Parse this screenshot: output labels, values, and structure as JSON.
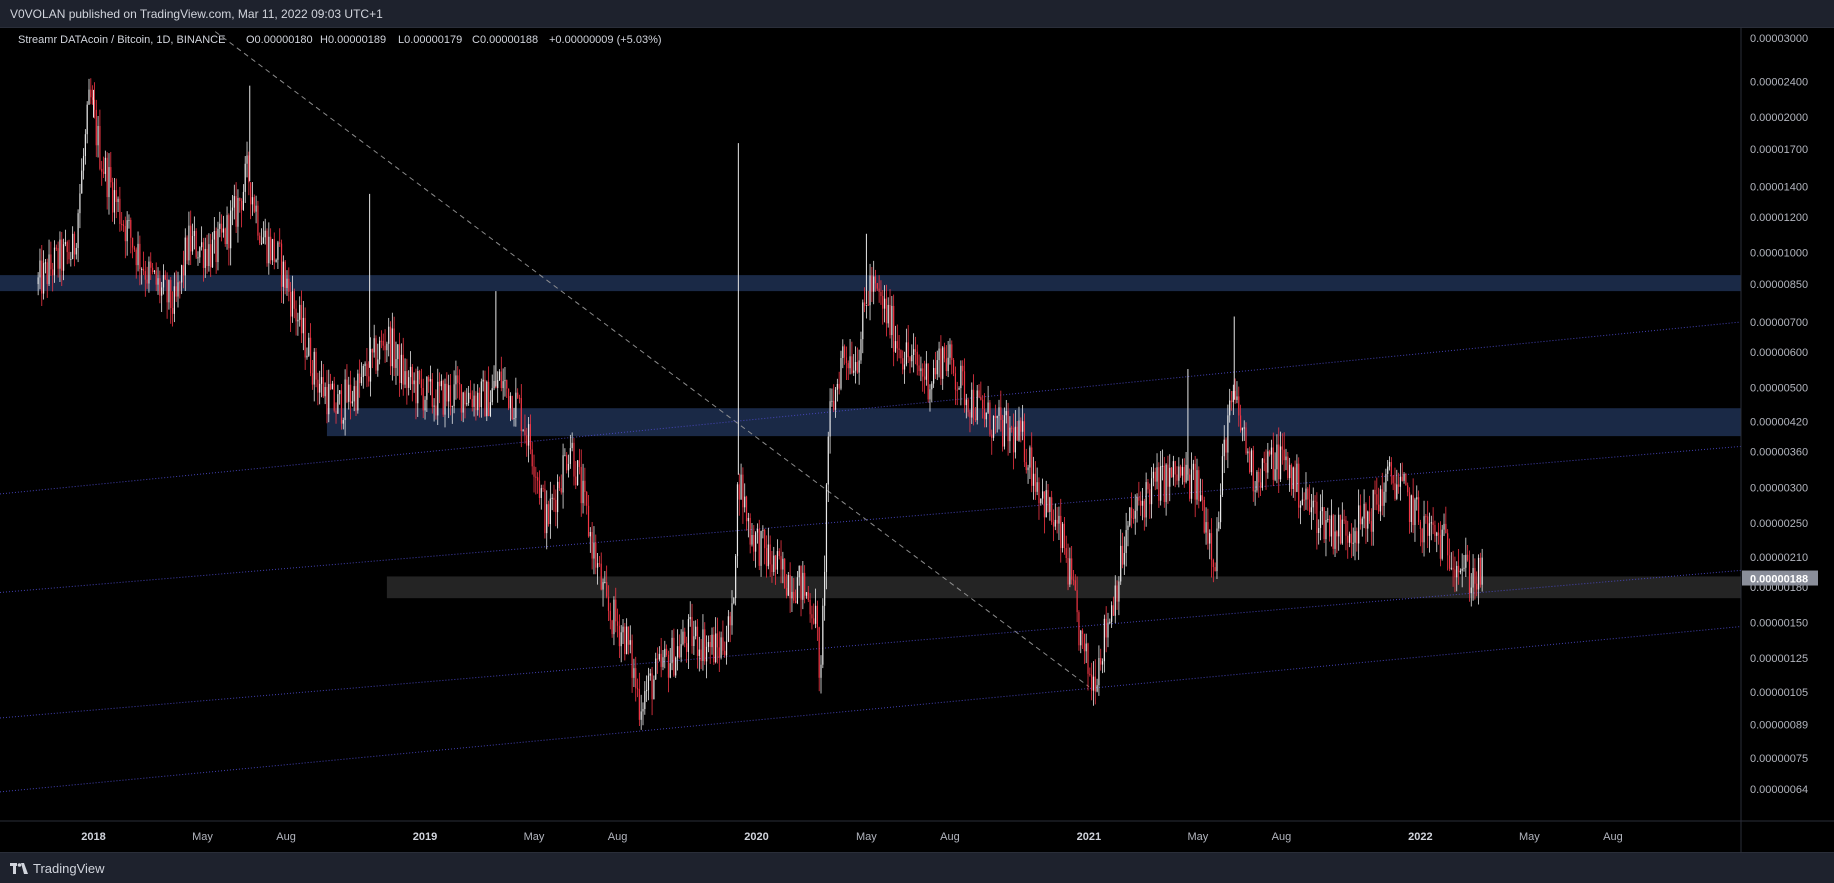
{
  "header": {
    "publish_text": "V0VOLAN published on TradingView.com, Mar 11, 2022 09:03 UTC+1"
  },
  "footer": {
    "brand_label": "TradingView"
  },
  "colors": {
    "background": "#000000",
    "frame": "#131722",
    "candle_up": "#e8e8e8",
    "candle_down": "#f23645",
    "zone_blue": "#1b2b4a",
    "zone_gray": "#2a2a2a",
    "channel_line": "#4b49c8",
    "trend_dash": "#9a9a9a",
    "price_label_bg": "#8a8e9a"
  },
  "chart_data": {
    "type": "candlestick",
    "legend": {
      "symbol": "Streamr DATAcoin / Bitcoin, 1D, BINANCE",
      "open": "O0.00000180",
      "high": "H0.00000189",
      "low": "L0.00000179",
      "close": "C0.00000188",
      "change": "+0.00000009 (+5.03%)"
    },
    "last_price_label": "0.00000188",
    "y_scale": "log",
    "ylim": [
      5.8e-07,
      3e-06
    ],
    "y_ticks": [
      "0.00003000",
      "0.00002400",
      "0.00002000",
      "0.00001700",
      "0.00001400",
      "0.00001200",
      "0.00001000",
      "0.00000850",
      "0.00000700",
      "0.00000600",
      "0.00000500",
      "0.00000420",
      "0.00000360",
      "0.00000300",
      "0.00000250",
      "0.00000210",
      "0.00000180",
      "0.00000150",
      "0.00000125",
      "0.00000105",
      "0.00000089",
      "0.00000075",
      "0.00000064"
    ],
    "x_ticks": [
      "2018",
      "May",
      "Aug",
      "2019",
      "May",
      "Aug",
      "2020",
      "May",
      "Aug",
      "2021",
      "May",
      "Aug",
      "2022",
      "May",
      "Aug"
    ],
    "x_tick_dates": [
      "2018-01-01",
      "2018-05-01",
      "2018-08-01",
      "2019-01-01",
      "2019-05-01",
      "2019-08-01",
      "2020-01-01",
      "2020-05-01",
      "2020-08-01",
      "2021-01-01",
      "2021-05-01",
      "2021-08-01",
      "2022-01-01",
      "2022-05-01",
      "2022-08-01"
    ],
    "x_range": [
      "2017-09-20",
      "2022-12-20"
    ],
    "price_path": [
      [
        "2017-11-01",
        8.5e-06
      ],
      [
        "2017-11-20",
        9.5e-06
      ],
      [
        "2017-12-10",
        1e-05
      ],
      [
        "2017-12-28",
        2.2e-05
      ],
      [
        "2018-01-10",
        1.6e-05
      ],
      [
        "2018-02-01",
        1.2e-05
      ],
      [
        "2018-03-01",
        9e-06
      ],
      [
        "2018-04-01",
        7.5e-06
      ],
      [
        "2018-04-15",
        1.05e-05
      ],
      [
        "2018-05-15",
        1e-05
      ],
      [
        "2018-06-05",
        1.2e-05
      ],
      [
        "2018-06-20",
        1.5e-05
      ],
      [
        "2018-07-05",
        1.1e-05
      ],
      [
        "2018-07-25",
        9.5e-06
      ],
      [
        "2018-08-15",
        7e-06
      ],
      [
        "2018-09-05",
        5.2e-06
      ],
      [
        "2018-09-25",
        4.5e-06
      ],
      [
        "2018-10-20",
        5e-06
      ],
      [
        "2018-11-20",
        6.5e-06
      ],
      [
        "2018-12-10",
        5.2e-06
      ],
      [
        "2019-01-10",
        4.7e-06
      ],
      [
        "2019-02-10",
        4.9e-06
      ],
      [
        "2019-03-10",
        4.7e-06
      ],
      [
        "2019-03-25",
        5.2e-06
      ],
      [
        "2019-04-15",
        4.5e-06
      ],
      [
        "2019-05-01",
        3.5e-06
      ],
      [
        "2019-05-15",
        2.5e-06
      ],
      [
        "2019-06-10",
        3.8e-06
      ],
      [
        "2019-07-01",
        2.4e-06
      ],
      [
        "2019-07-20",
        1.6e-06
      ],
      [
        "2019-08-10",
        1.4e-06
      ],
      [
        "2019-08-25",
        1e-06
      ],
      [
        "2019-09-20",
        1.2e-06
      ],
      [
        "2019-10-20",
        1.4e-06
      ],
      [
        "2019-11-20",
        1.3e-06
      ],
      [
        "2019-12-05",
        1.5e-06
      ],
      [
        "2019-12-12",
        3.2e-06
      ],
      [
        "2019-12-25",
        2.4e-06
      ],
      [
        "2020-01-20",
        2e-06
      ],
      [
        "2020-02-20",
        1.8e-06
      ],
      [
        "2020-03-05",
        1.6e-06
      ],
      [
        "2020-03-12",
        1.1e-06
      ],
      [
        "2020-03-20",
        4e-06
      ],
      [
        "2020-04-05",
        6e-06
      ],
      [
        "2020-04-20",
        5.8e-06
      ],
      [
        "2020-05-05",
        8.5e-06
      ],
      [
        "2020-05-20",
        7.5e-06
      ],
      [
        "2020-06-10",
        6e-06
      ],
      [
        "2020-07-10",
        5.2e-06
      ],
      [
        "2020-07-25",
        6e-06
      ],
      [
        "2020-08-20",
        4.8e-06
      ],
      [
        "2020-09-20",
        4.1e-06
      ],
      [
        "2020-10-20",
        3.8e-06
      ],
      [
        "2020-11-10",
        2.9e-06
      ],
      [
        "2020-12-05",
        2.2e-06
      ],
      [
        "2020-12-25",
        1.3e-06
      ],
      [
        "2021-01-05",
        1.1e-06
      ],
      [
        "2021-01-25",
        1.6e-06
      ],
      [
        "2021-02-15",
        2.5e-06
      ],
      [
        "2021-03-10",
        3e-06
      ],
      [
        "2021-04-10",
        3.2e-06
      ],
      [
        "2021-05-01",
        3e-06
      ],
      [
        "2021-05-20",
        2.1e-06
      ],
      [
        "2021-06-01",
        4e-06
      ],
      [
        "2021-06-10",
        4.7e-06
      ],
      [
        "2021-07-01",
        3.2e-06
      ],
      [
        "2021-08-01",
        3.5e-06
      ],
      [
        "2021-09-01",
        2.7e-06
      ],
      [
        "2021-10-01",
        2.4e-06
      ],
      [
        "2021-11-01",
        2.5e-06
      ],
      [
        "2021-12-01",
        3.2e-06
      ],
      [
        "2022-01-01",
        2.5e-06
      ],
      [
        "2022-02-01",
        2.2e-06
      ],
      [
        "2022-02-25",
        1.9e-06
      ],
      [
        "2022-03-11",
        1.88e-06
      ]
    ],
    "spikes": [
      [
        "2018-01-01",
        2.3e-05
      ],
      [
        "2018-06-22",
        2.35e-05
      ],
      [
        "2018-11-01",
        1.35e-05
      ],
      [
        "2019-03-20",
        8.2e-06
      ],
      [
        "2019-12-12",
        1.75e-05
      ],
      [
        "2020-03-22",
        4.2e-06
      ],
      [
        "2020-05-01",
        1.1e-05
      ],
      [
        "2021-04-20",
        5.5e-06
      ],
      [
        "2021-06-10",
        7.2e-06
      ]
    ],
    "zones": [
      {
        "from": "2017-07-01",
        "to": "2022-12-20",
        "high": 8.9e-06,
        "low": 8.2e-06,
        "color": "zone_blue"
      },
      {
        "from": "2018-09-15",
        "to": "2022-12-20",
        "high": 4.5e-06,
        "low": 3.9e-06,
        "color": "zone_blue"
      },
      {
        "from": "2018-11-20",
        "to": "2022-12-20",
        "high": 1.9e-06,
        "low": 1.7e-06,
        "color": "zone_gray"
      }
    ],
    "trendlines": [
      {
        "style": "dashed",
        "from": [
          "2018-05-15",
          3.1e-05
        ],
        "to": [
          "2021-01-01",
          1.08e-06
        ]
      },
      {
        "style": "dotted",
        "from": [
          "2017-09-20",
          2.9e-06
        ],
        "to": [
          "2022-12-20",
          7e-06
        ]
      },
      {
        "style": "dotted",
        "from": [
          "2017-09-20",
          1.75e-06
        ],
        "to": [
          "2022-12-20",
          3.7e-06
        ]
      },
      {
        "style": "dotted",
        "from": [
          "2017-09-20",
          9.2e-07
        ],
        "to": [
          "2022-12-20",
          1.96e-06
        ]
      },
      {
        "style": "dotted",
        "from": [
          "2017-09-20",
          6.3e-07
        ],
        "to": [
          "2022-12-20",
          1.47e-06
        ]
      }
    ]
  }
}
